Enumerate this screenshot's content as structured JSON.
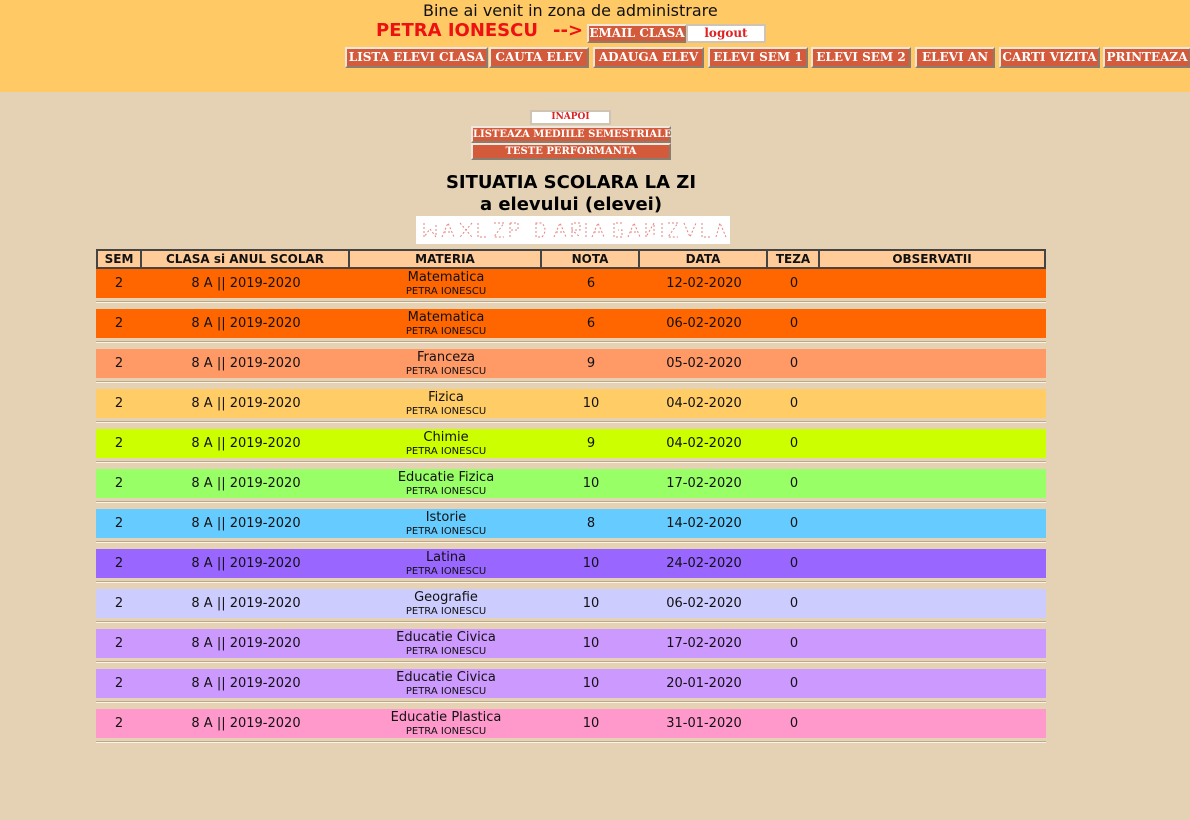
{
  "header": {
    "welcome": "Bine ai venit in zona de administrare",
    "username": "PETRA IONESCU",
    "arrow": "-->",
    "email_button": "EMAIL CLASA",
    "logout_button": "logout"
  },
  "nav": [
    "LISTA ELEVI CLASA",
    "CAUTA ELEV",
    "ADAUGA ELEV",
    "ELEVI SEM 1",
    "ELEVI SEM 2",
    "ELEVI AN",
    "CARTI VIZITA",
    "PRINTEAZA"
  ],
  "actions": {
    "back": "INAPOI",
    "averages": "LISTEAZA MEDIILE SEMESTRIALE",
    "tests": "TESTE PERFORMANTA"
  },
  "title": {
    "line1": "SITUATIA SCOLARA LA ZI",
    "line2": "a elevului (elevei)"
  },
  "table": {
    "headers": [
      "SEM",
      "CLASA si ANUL SCOLAR",
      "MATERIA",
      "NOTA",
      "DATA",
      "TEZA",
      "OBSERVATII"
    ],
    "rows": [
      {
        "sem": "2",
        "clasa": "8 A || 2019-2020",
        "materia": "Matematica",
        "profesor": "PETRA IONESCU",
        "nota": "6",
        "data": "12-02-2020",
        "teza": "0",
        "observatii": "",
        "color": "#ff6600"
      },
      {
        "sem": "2",
        "clasa": "8 A || 2019-2020",
        "materia": "Matematica",
        "profesor": "PETRA IONESCU",
        "nota": "6",
        "data": "06-02-2020",
        "teza": "0",
        "observatii": "",
        "color": "#ff6600"
      },
      {
        "sem": "2",
        "clasa": "8 A || 2019-2020",
        "materia": "Franceza",
        "profesor": "PETRA IONESCU",
        "nota": "9",
        "data": "05-02-2020",
        "teza": "0",
        "observatii": "",
        "color": "#ff9966"
      },
      {
        "sem": "2",
        "clasa": "8 A || 2019-2020",
        "materia": "Fizica",
        "profesor": "PETRA IONESCU",
        "nota": "10",
        "data": "04-02-2020",
        "teza": "0",
        "observatii": "",
        "color": "#ffcc66"
      },
      {
        "sem": "2",
        "clasa": "8 A || 2019-2020",
        "materia": "Chimie",
        "profesor": "PETRA IONESCU",
        "nota": "9",
        "data": "04-02-2020",
        "teza": "0",
        "observatii": "",
        "color": "#ccff00"
      },
      {
        "sem": "2",
        "clasa": "8 A || 2019-2020",
        "materia": "Educatie Fizica",
        "profesor": "PETRA IONESCU",
        "nota": "10",
        "data": "17-02-2020",
        "teza": "0",
        "observatii": "",
        "color": "#99ff66"
      },
      {
        "sem": "2",
        "clasa": "8 A || 2019-2020",
        "materia": "Istorie",
        "profesor": "PETRA IONESCU",
        "nota": "8",
        "data": "14-02-2020",
        "teza": "0",
        "observatii": "",
        "color": "#66ccff"
      },
      {
        "sem": "2",
        "clasa": "8 A || 2019-2020",
        "materia": "Latina",
        "profesor": "PETRA IONESCU",
        "nota": "10",
        "data": "24-02-2020",
        "teza": "0",
        "observatii": "",
        "color": "#9966ff"
      },
      {
        "sem": "2",
        "clasa": "8 A || 2019-2020",
        "materia": "Geografie",
        "profesor": "PETRA IONESCU",
        "nota": "10",
        "data": "06-02-2020",
        "teza": "0",
        "observatii": "",
        "color": "#ccccff"
      },
      {
        "sem": "2",
        "clasa": "8 A || 2019-2020",
        "materia": "Educatie Civica",
        "profesor": "PETRA IONESCU",
        "nota": "10",
        "data": "17-02-2020",
        "teza": "0",
        "observatii": "",
        "color": "#cc99ff"
      },
      {
        "sem": "2",
        "clasa": "8 A || 2019-2020",
        "materia": "Educatie Civica",
        "profesor": "PETRA IONESCU",
        "nota": "10",
        "data": "20-01-2020",
        "teza": "0",
        "observatii": "",
        "color": "#cc99ff"
      },
      {
        "sem": "2",
        "clasa": "8 A || 2019-2020",
        "materia": "Educatie Plastica",
        "profesor": "PETRA IONESCU",
        "nota": "10",
        "data": "31-01-2020",
        "teza": "0",
        "observatii": "",
        "color": "#ff99cc"
      }
    ]
  },
  "colors": {
    "header_bg": "#ffc966",
    "page_bg": "#e5d2b5",
    "button_bg": "#d35a3a",
    "accent_red": "#ee1111",
    "table_header_bg": "#ffcc99"
  }
}
